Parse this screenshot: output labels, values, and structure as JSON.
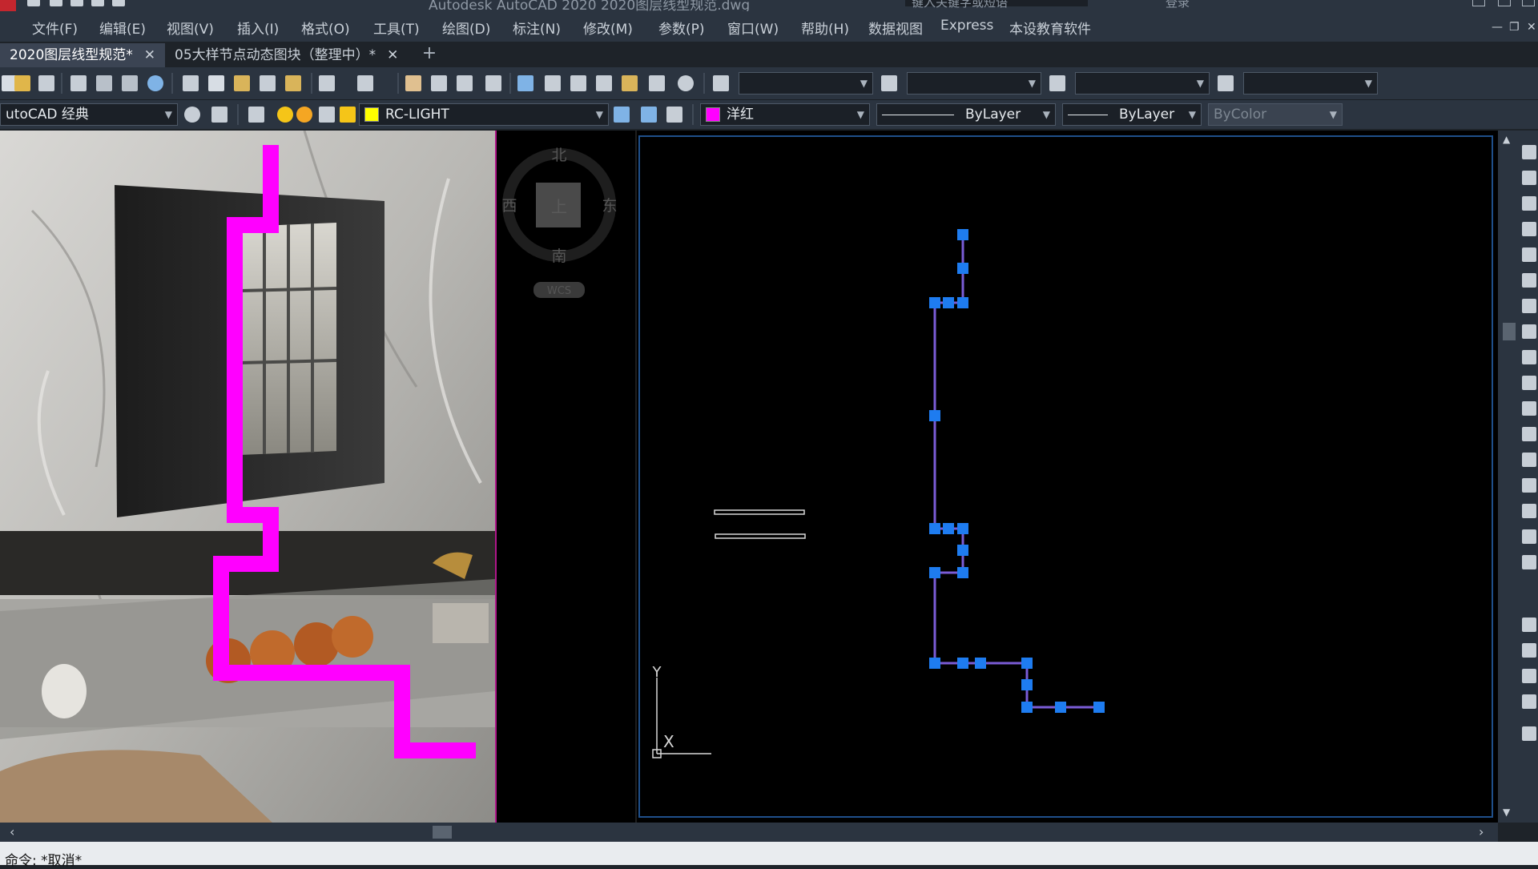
{
  "window": {
    "title": "Autodesk AutoCAD 2020   2020图层线型规范.dwg",
    "search_placeholder": "键入关键字或短语",
    "login_label": "登录"
  },
  "menubar": {
    "items": [
      "文件(F)",
      "编辑(E)",
      "视图(V)",
      "插入(I)",
      "格式(O)",
      "工具(T)",
      "绘图(D)",
      "标注(N)",
      "修改(M)",
      "参数(P)",
      "窗口(W)",
      "帮助(H)",
      "数据视图",
      "Express",
      "本设教育软件"
    ]
  },
  "tabs": [
    {
      "label": "2020图层线型规范*",
      "active": true
    },
    {
      "label": "05大样节点动态图块（整理中）*",
      "active": false
    }
  ],
  "toolbar1": {
    "combos": [
      "",
      "",
      "",
      ""
    ]
  },
  "toolbar2": {
    "workspace": "utoCAD 经典",
    "layer": "RC-LIGHT",
    "layer_color": "#ffff00",
    "color": "洋红",
    "color_swatch": "#ff00ff",
    "linetype": "ByLayer",
    "lineweight": "ByLayer",
    "plotstyle": "ByColor"
  },
  "viewcube": {
    "north": "北",
    "south": "南",
    "east": "东",
    "west": "西",
    "face": "上",
    "wcs": "WCS"
  },
  "ucs": {
    "x_label": "X",
    "y_label": "Y"
  },
  "colors": {
    "magenta": "#ff00ff",
    "grip": "#1e7cf0",
    "polyline": "#7a5cd6",
    "canvas": "#000000"
  },
  "command_line": {
    "text": "命令: *取消*"
  }
}
